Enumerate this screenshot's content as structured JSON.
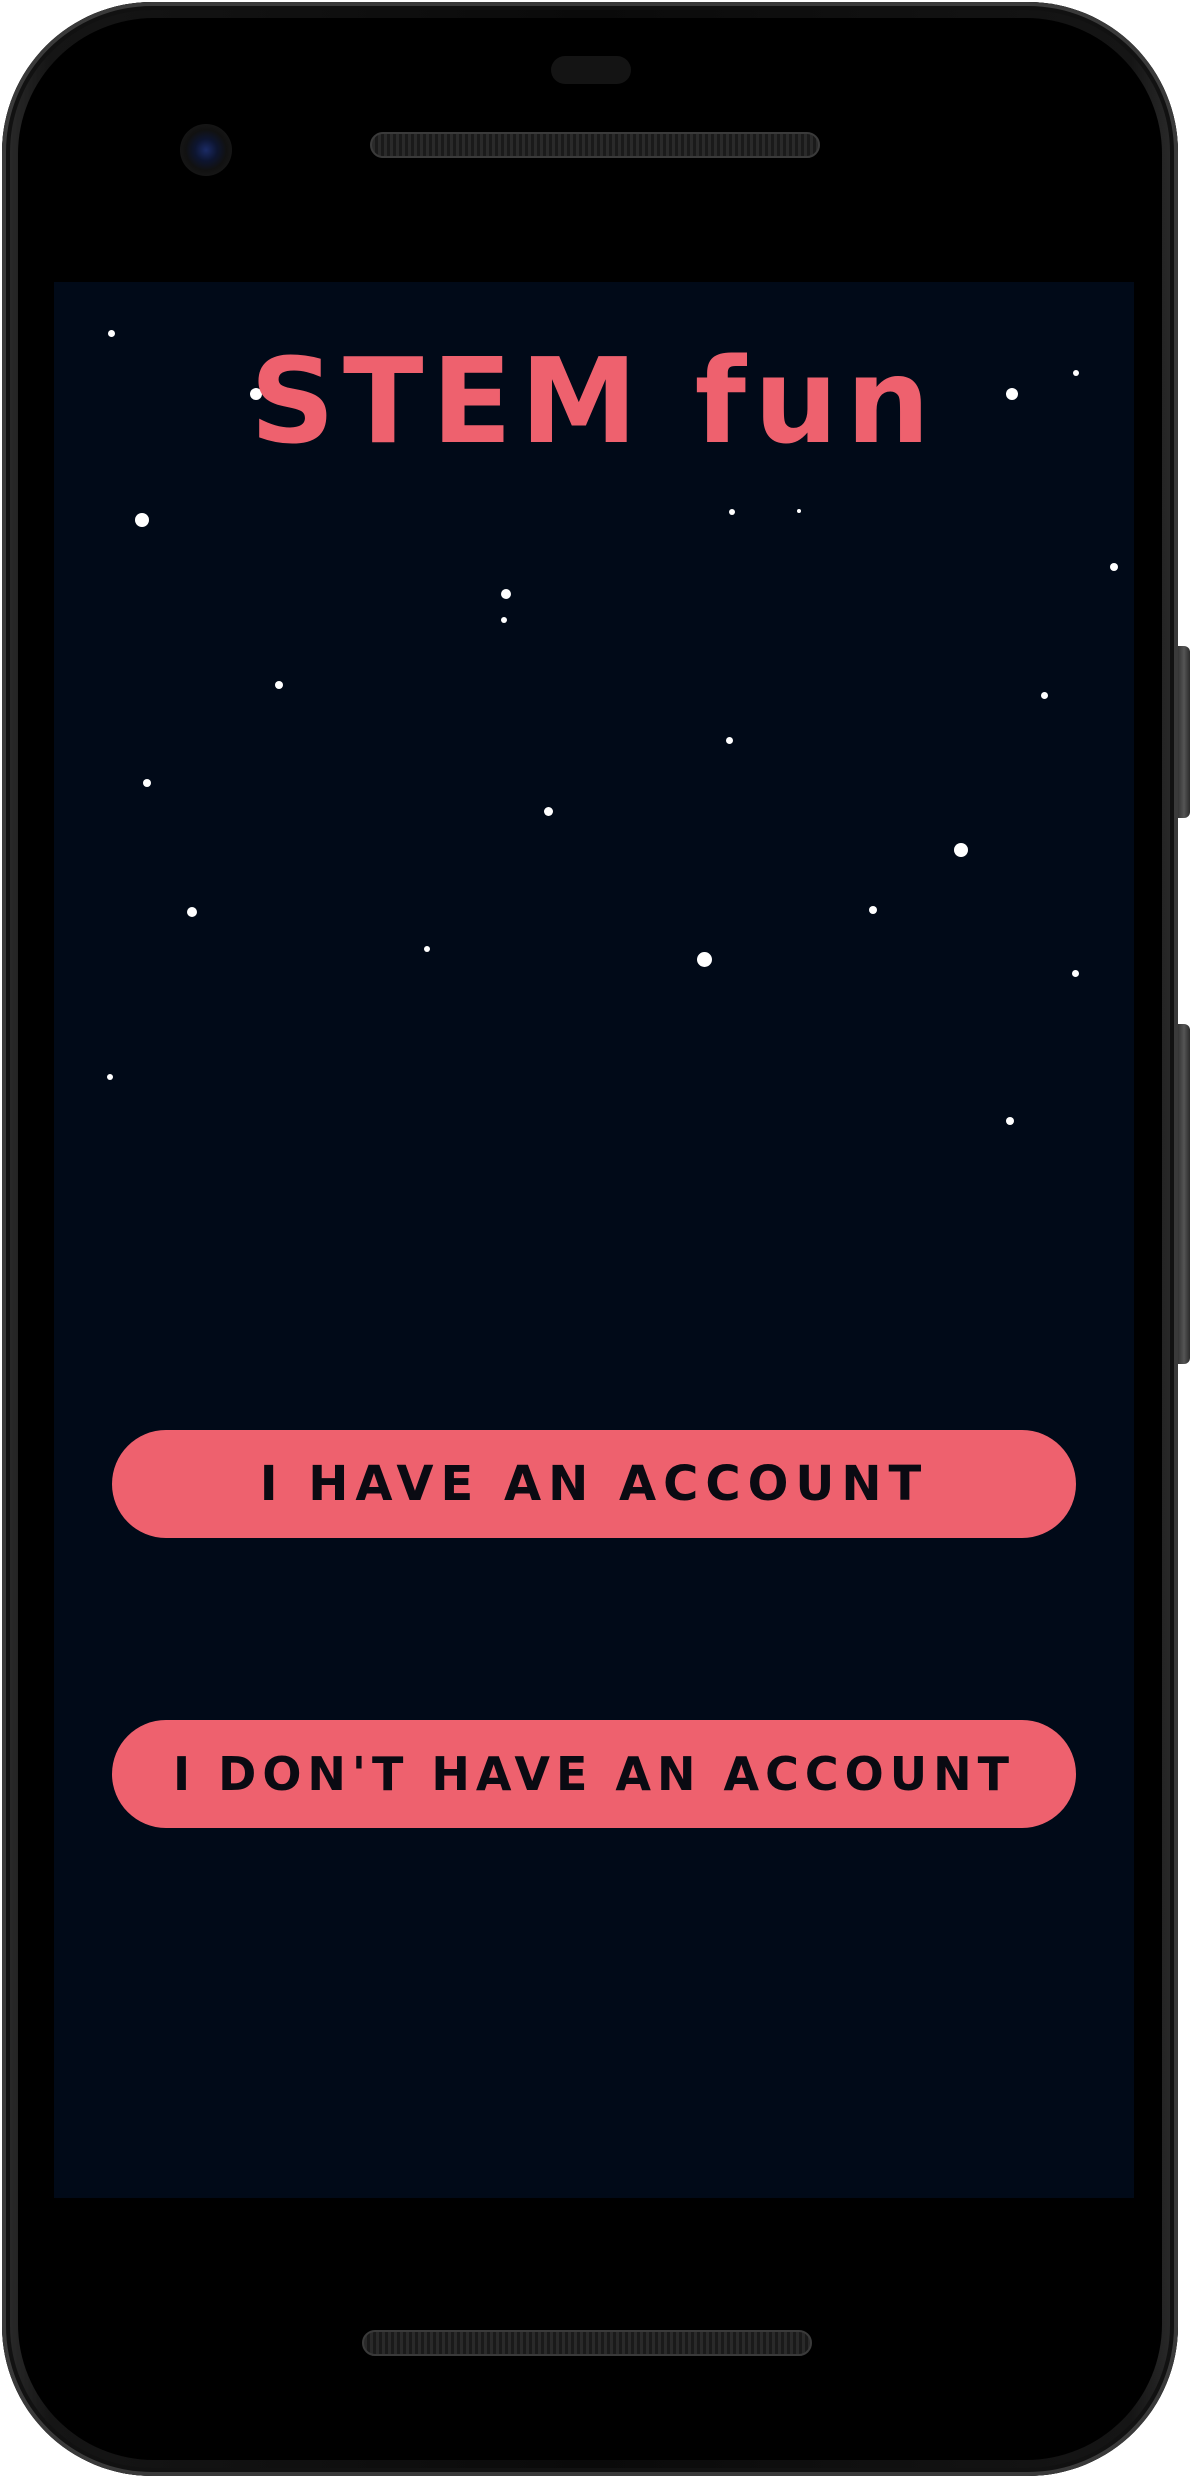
{
  "app": {
    "title": "STEM fun",
    "background_color": "#010a18",
    "accent_color": "#ee616e"
  },
  "actions": {
    "have_account_label": "I HAVE AN ACCOUNT",
    "no_account_label": "I DON'T HAVE AN ACCOUNT"
  },
  "decor": {
    "background_icon": "starfield"
  }
}
